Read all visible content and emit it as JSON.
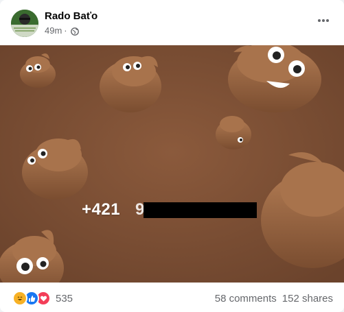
{
  "post": {
    "author": "Rado Baťo",
    "time": "49m",
    "separator": "·",
    "privacy_icon": "globe-icon",
    "more_icon": "more-options-icon",
    "more_label": "···"
  },
  "media": {
    "phone_prefix": "+421 ",
    "phone_visible_tail": "9",
    "phone_redacted": true,
    "background_color": "#7a5036",
    "subject": "poop-emoji-pattern"
  },
  "footer": {
    "reaction_icons": [
      "haha-reaction-icon",
      "like-reaction-icon",
      "love-reaction-icon"
    ],
    "reaction_count": "535",
    "comments": "58 comments",
    "shares": "152 shares"
  },
  "colors": {
    "text_primary": "#050505",
    "text_secondary": "#65676b",
    "like_blue": "#1877f2",
    "love_red": "#f33e58",
    "haha_yellow": "#f7b125"
  }
}
